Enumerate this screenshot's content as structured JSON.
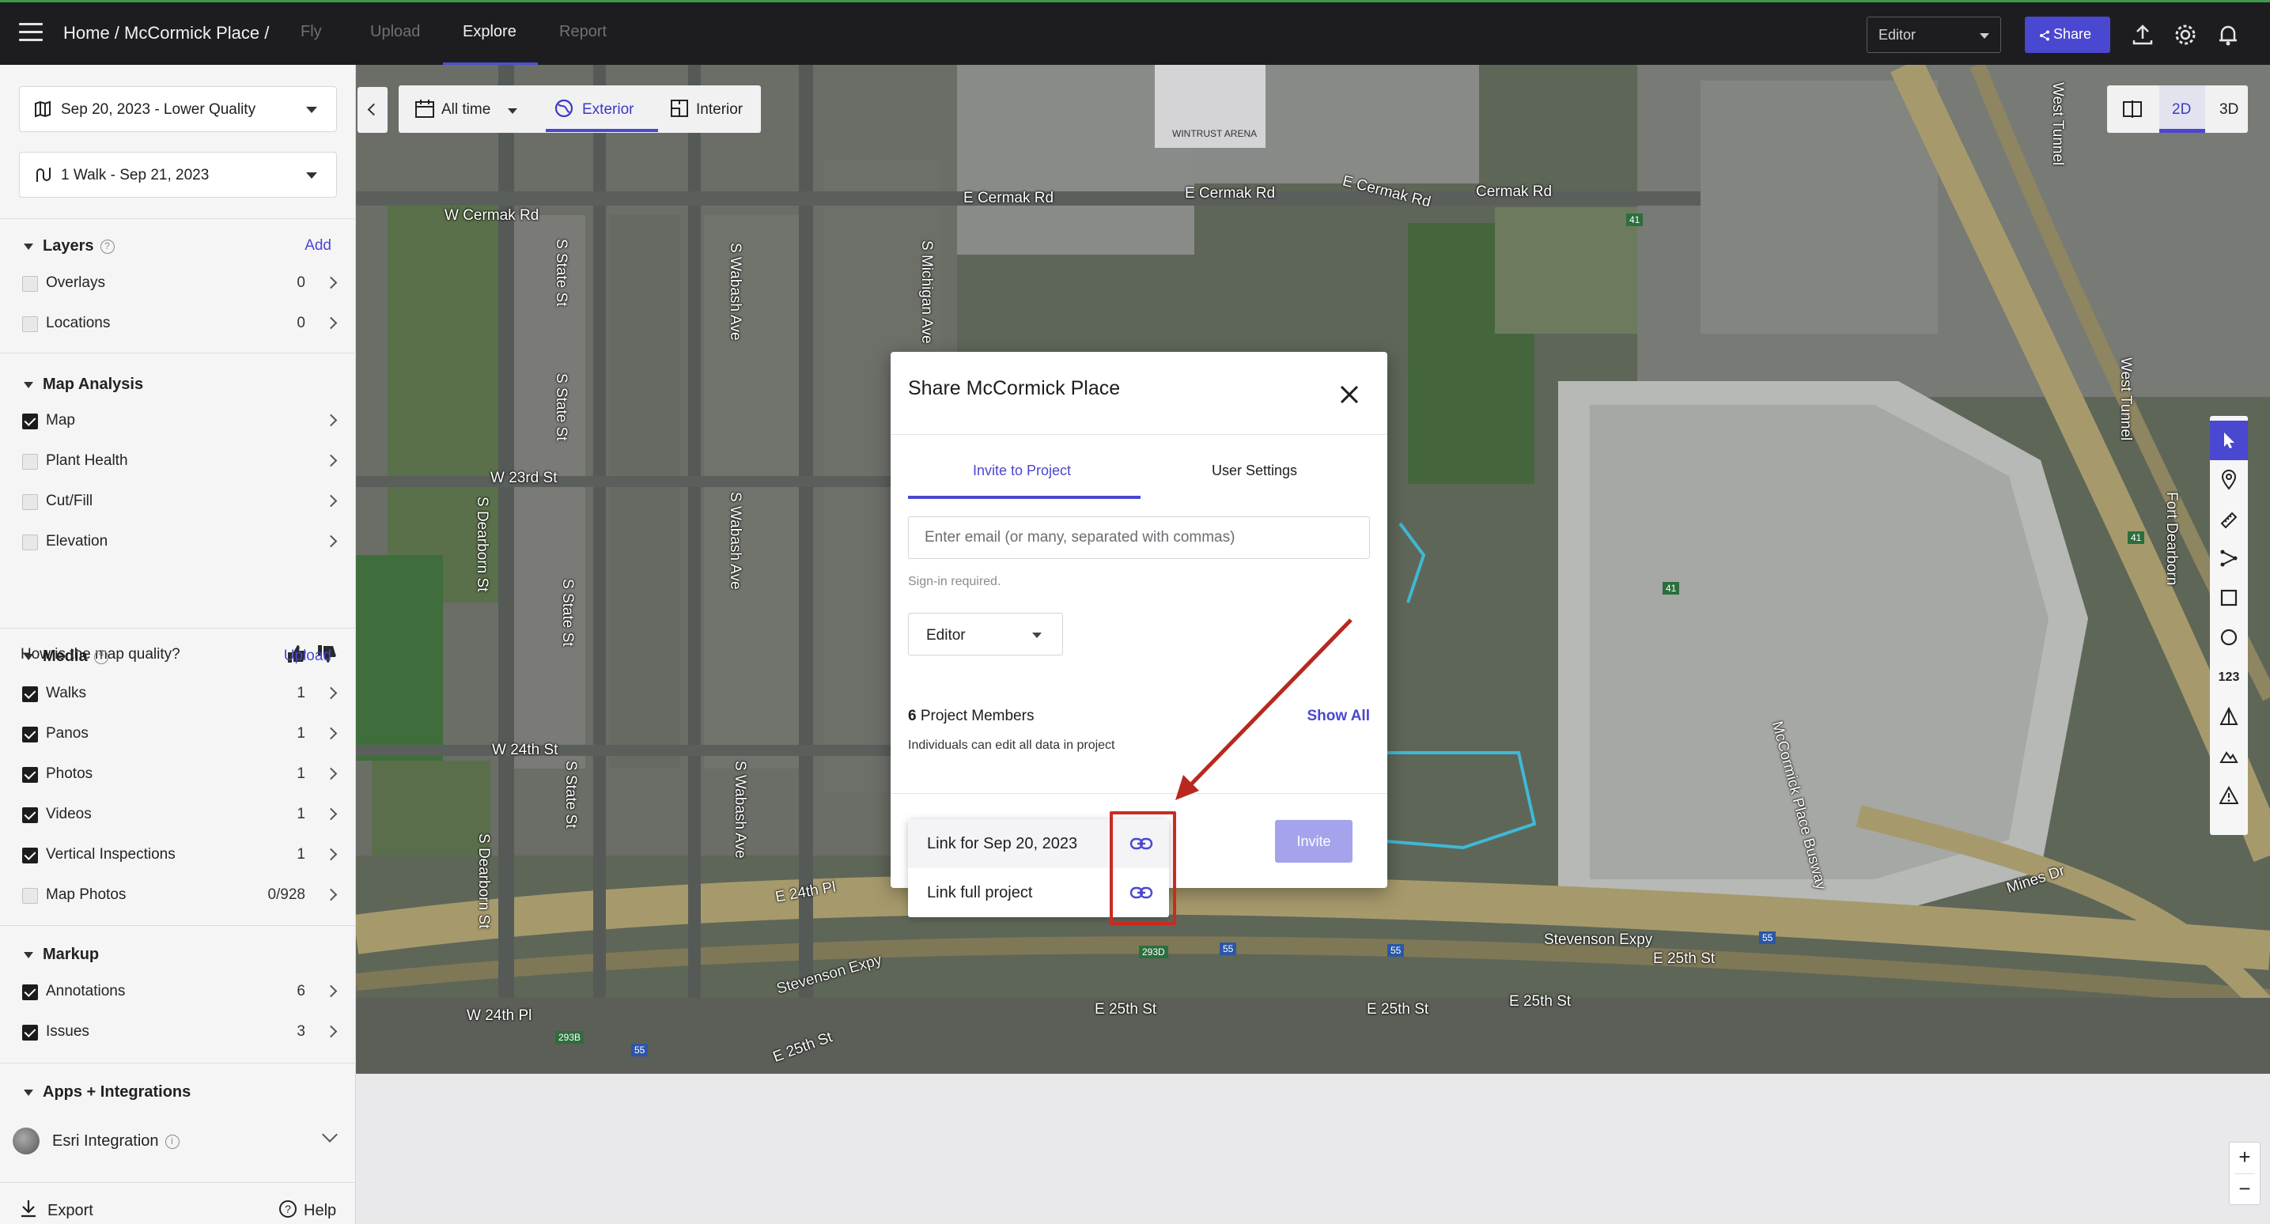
{
  "header": {
    "breadcrumb": "Home / McCormick Place /",
    "tabs": [
      {
        "label": "Fly",
        "active": false
      },
      {
        "label": "Upload",
        "active": false
      },
      {
        "label": "Explore",
        "active": true
      },
      {
        "label": "Report",
        "active": false
      }
    ],
    "role_selected": "Editor",
    "share_label": "Share"
  },
  "sidebar": {
    "capture_select": "Sep 20, 2023 - Lower Quality",
    "walk_select": "1 Walk - Sep 21, 2023",
    "layers": {
      "title": "Layers",
      "action": "Add",
      "items": [
        {
          "label": "Overlays",
          "count": "0",
          "checked": false
        },
        {
          "label": "Locations",
          "count": "0",
          "checked": false
        }
      ]
    },
    "map_analysis": {
      "title": "Map Analysis",
      "items": [
        {
          "label": "Map",
          "checked": true
        },
        {
          "label": "Plant Health",
          "checked": false
        },
        {
          "label": "Cut/Fill",
          "checked": false
        },
        {
          "label": "Elevation",
          "checked": false
        }
      ],
      "quality_question": "How is the map quality?"
    },
    "media": {
      "title": "Media",
      "action": "Upload",
      "items": [
        {
          "label": "Walks",
          "count": "1",
          "checked": true
        },
        {
          "label": "Panos",
          "count": "1",
          "checked": true
        },
        {
          "label": "Photos",
          "count": "1",
          "checked": true
        },
        {
          "label": "Videos",
          "count": "1",
          "checked": true
        },
        {
          "label": "Vertical Inspections",
          "count": "1",
          "checked": true
        },
        {
          "label": "Map Photos",
          "count": "0/928",
          "checked": false
        }
      ]
    },
    "markup": {
      "title": "Markup",
      "items": [
        {
          "label": "Annotations",
          "count": "6",
          "checked": true
        },
        {
          "label": "Issues",
          "count": "3",
          "checked": true
        }
      ]
    },
    "apps": {
      "title": "Apps + Integrations",
      "esri": "Esri Integration"
    },
    "footer": {
      "export": "Export",
      "help": "Help"
    }
  },
  "map_toolbar": {
    "time": "All time",
    "exterior": "Exterior",
    "interior": "Interior",
    "view_2d": "2D",
    "view_3d": "3D",
    "measure": "123",
    "zoom_in": "+",
    "zoom_out": "−"
  },
  "map_labels": {
    "w_cermak": "W Cermak Rd",
    "e_cermak_1": "E Cermak Rd",
    "e_cermak_2": "E Cermak Rd",
    "e_cermak_3": "E Cermak Rd",
    "cermak": "Cermak Rd",
    "state_1": "S State St",
    "state_2": "S State St",
    "state_3": "S State St",
    "state_4": "S State St",
    "wabash_1": "S Wabash Ave",
    "wabash_2": "S Wabash Ave",
    "wabash_3": "S Wabash Ave",
    "michigan": "S Michigan Ave",
    "dearborn_1": "S Dearborn St",
    "dearborn_2": "S Dearborn St",
    "w23": "W 23rd St",
    "w24": "W 24th St",
    "w24pl": "W 24th Pl",
    "e24pl": "E 24th Pl",
    "e25_1": "E 25th St",
    "e25_2": "E 25th St",
    "e25_3": "E 25th St",
    "e25_4": "E 25th St",
    "e25_5": "E 25th St",
    "stevenson_1": "Stevenson Expy",
    "stevenson_2": "Stevenson Expy",
    "mines": "Mines Dr",
    "mccormick_bus": "McCormick Place Busway",
    "west_tunnel_1": "West Tunnel",
    "west_tunnel_2": "West Tunnel",
    "fort_dearborn": "Fort Dearborn",
    "arena": "WINTRUST ARENA",
    "shield_41a": "41",
    "shield_41b": "41",
    "shield_41c": "41",
    "shield_55a": "55",
    "shield_55b": "55",
    "shield_55c": "55",
    "shield_55d": "55",
    "shield_2938": "293B",
    "shield_2930": "293D"
  },
  "modal": {
    "title": "Share McCormick Place",
    "tabs": [
      {
        "label": "Invite to Project",
        "active": true
      },
      {
        "label": "User Settings",
        "active": false
      }
    ],
    "email_placeholder": "Enter email (or many, separated with commas)",
    "sign_in_note": "Sign-in required.",
    "role": "Editor",
    "members_count": "6",
    "members_label": "Project Members",
    "show_all": "Show All",
    "members_note": "Individuals can edit all data in project",
    "invite": "Invite",
    "link_menu": [
      {
        "label": "Link for Sep 20, 2023"
      },
      {
        "label": "Link full project"
      }
    ]
  },
  "colors": {
    "accent": "#4a47d0",
    "annotation_red": "#c92b22",
    "topbar": "#1d1d20"
  }
}
